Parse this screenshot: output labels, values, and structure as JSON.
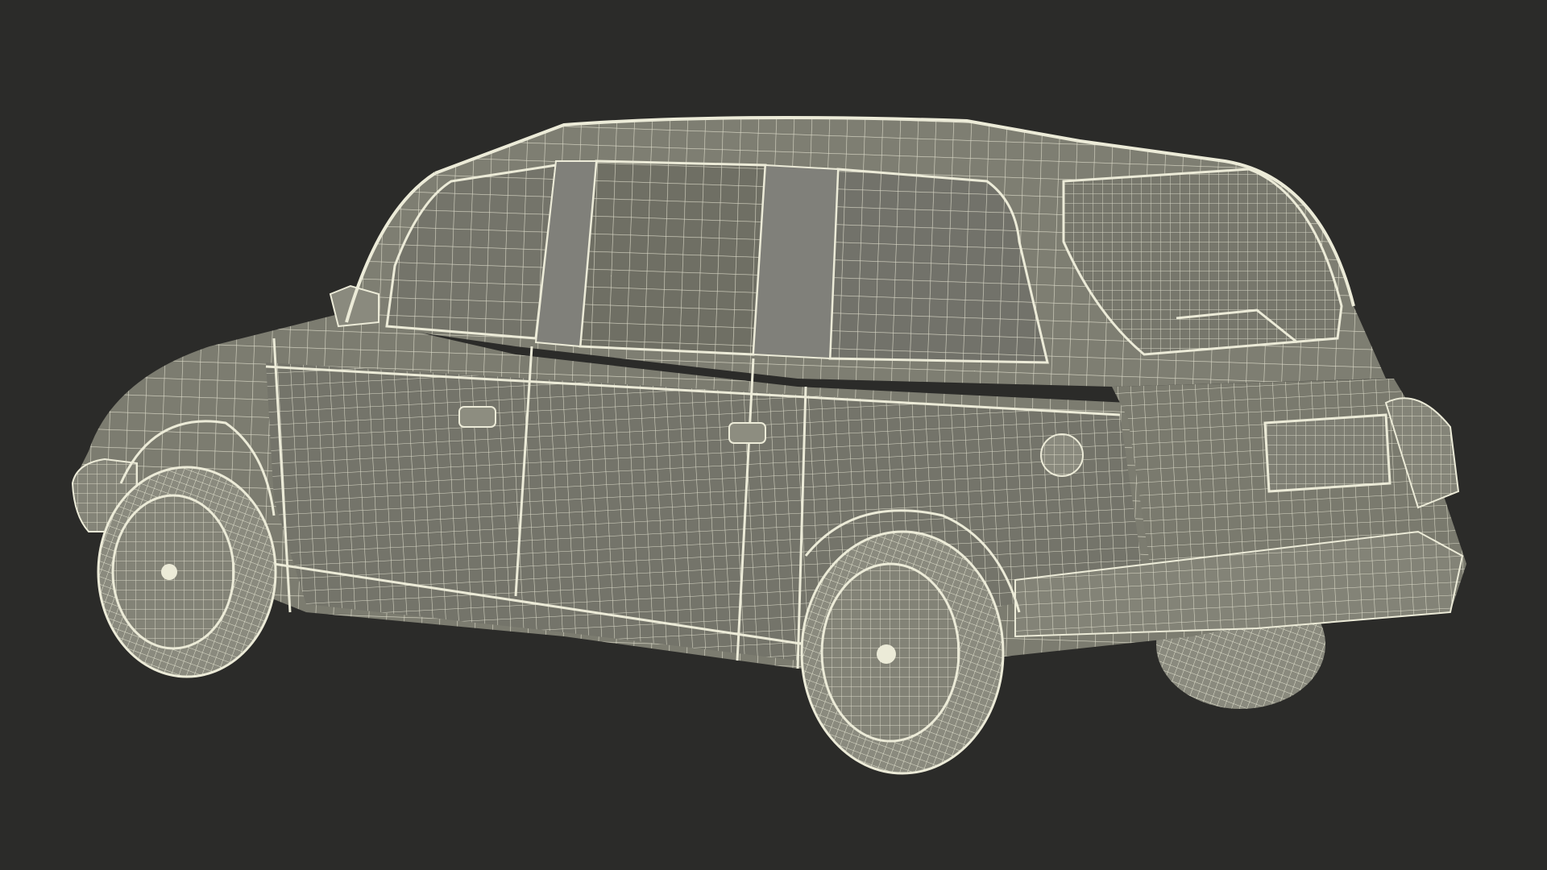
{
  "scene": {
    "subject": "taxi-wireframe-model",
    "colors": {
      "background": "#2b2b29",
      "body_fill": "#7c7c70",
      "body_shade": "#6c6c61",
      "glass_fill": "#75756a",
      "wire": "#ecebd8",
      "tire_fill": "#8a8a7e"
    }
  }
}
